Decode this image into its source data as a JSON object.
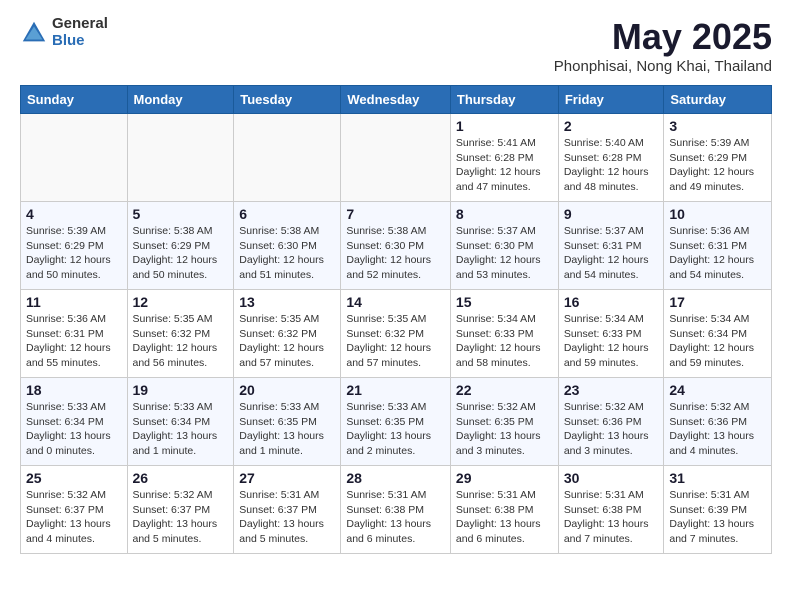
{
  "header": {
    "logo_general": "General",
    "logo_blue": "Blue",
    "month_title": "May 2025",
    "location": "Phonphisai, Nong Khai, Thailand"
  },
  "days_of_week": [
    "Sunday",
    "Monday",
    "Tuesday",
    "Wednesday",
    "Thursday",
    "Friday",
    "Saturday"
  ],
  "weeks": [
    [
      {
        "day": "",
        "info": ""
      },
      {
        "day": "",
        "info": ""
      },
      {
        "day": "",
        "info": ""
      },
      {
        "day": "",
        "info": ""
      },
      {
        "day": "1",
        "info": "Sunrise: 5:41 AM\nSunset: 6:28 PM\nDaylight: 12 hours\nand 47 minutes."
      },
      {
        "day": "2",
        "info": "Sunrise: 5:40 AM\nSunset: 6:28 PM\nDaylight: 12 hours\nand 48 minutes."
      },
      {
        "day": "3",
        "info": "Sunrise: 5:39 AM\nSunset: 6:29 PM\nDaylight: 12 hours\nand 49 minutes."
      }
    ],
    [
      {
        "day": "4",
        "info": "Sunrise: 5:39 AM\nSunset: 6:29 PM\nDaylight: 12 hours\nand 50 minutes."
      },
      {
        "day": "5",
        "info": "Sunrise: 5:38 AM\nSunset: 6:29 PM\nDaylight: 12 hours\nand 50 minutes."
      },
      {
        "day": "6",
        "info": "Sunrise: 5:38 AM\nSunset: 6:30 PM\nDaylight: 12 hours\nand 51 minutes."
      },
      {
        "day": "7",
        "info": "Sunrise: 5:38 AM\nSunset: 6:30 PM\nDaylight: 12 hours\nand 52 minutes."
      },
      {
        "day": "8",
        "info": "Sunrise: 5:37 AM\nSunset: 6:30 PM\nDaylight: 12 hours\nand 53 minutes."
      },
      {
        "day": "9",
        "info": "Sunrise: 5:37 AM\nSunset: 6:31 PM\nDaylight: 12 hours\nand 54 minutes."
      },
      {
        "day": "10",
        "info": "Sunrise: 5:36 AM\nSunset: 6:31 PM\nDaylight: 12 hours\nand 54 minutes."
      }
    ],
    [
      {
        "day": "11",
        "info": "Sunrise: 5:36 AM\nSunset: 6:31 PM\nDaylight: 12 hours\nand 55 minutes."
      },
      {
        "day": "12",
        "info": "Sunrise: 5:35 AM\nSunset: 6:32 PM\nDaylight: 12 hours\nand 56 minutes."
      },
      {
        "day": "13",
        "info": "Sunrise: 5:35 AM\nSunset: 6:32 PM\nDaylight: 12 hours\nand 57 minutes."
      },
      {
        "day": "14",
        "info": "Sunrise: 5:35 AM\nSunset: 6:32 PM\nDaylight: 12 hours\nand 57 minutes."
      },
      {
        "day": "15",
        "info": "Sunrise: 5:34 AM\nSunset: 6:33 PM\nDaylight: 12 hours\nand 58 minutes."
      },
      {
        "day": "16",
        "info": "Sunrise: 5:34 AM\nSunset: 6:33 PM\nDaylight: 12 hours\nand 59 minutes."
      },
      {
        "day": "17",
        "info": "Sunrise: 5:34 AM\nSunset: 6:34 PM\nDaylight: 12 hours\nand 59 minutes."
      }
    ],
    [
      {
        "day": "18",
        "info": "Sunrise: 5:33 AM\nSunset: 6:34 PM\nDaylight: 13 hours\nand 0 minutes."
      },
      {
        "day": "19",
        "info": "Sunrise: 5:33 AM\nSunset: 6:34 PM\nDaylight: 13 hours\nand 1 minute."
      },
      {
        "day": "20",
        "info": "Sunrise: 5:33 AM\nSunset: 6:35 PM\nDaylight: 13 hours\nand 1 minute."
      },
      {
        "day": "21",
        "info": "Sunrise: 5:33 AM\nSunset: 6:35 PM\nDaylight: 13 hours\nand 2 minutes."
      },
      {
        "day": "22",
        "info": "Sunrise: 5:32 AM\nSunset: 6:35 PM\nDaylight: 13 hours\nand 3 minutes."
      },
      {
        "day": "23",
        "info": "Sunrise: 5:32 AM\nSunset: 6:36 PM\nDaylight: 13 hours\nand 3 minutes."
      },
      {
        "day": "24",
        "info": "Sunrise: 5:32 AM\nSunset: 6:36 PM\nDaylight: 13 hours\nand 4 minutes."
      }
    ],
    [
      {
        "day": "25",
        "info": "Sunrise: 5:32 AM\nSunset: 6:37 PM\nDaylight: 13 hours\nand 4 minutes."
      },
      {
        "day": "26",
        "info": "Sunrise: 5:32 AM\nSunset: 6:37 PM\nDaylight: 13 hours\nand 5 minutes."
      },
      {
        "day": "27",
        "info": "Sunrise: 5:31 AM\nSunset: 6:37 PM\nDaylight: 13 hours\nand 5 minutes."
      },
      {
        "day": "28",
        "info": "Sunrise: 5:31 AM\nSunset: 6:38 PM\nDaylight: 13 hours\nand 6 minutes."
      },
      {
        "day": "29",
        "info": "Sunrise: 5:31 AM\nSunset: 6:38 PM\nDaylight: 13 hours\nand 6 minutes."
      },
      {
        "day": "30",
        "info": "Sunrise: 5:31 AM\nSunset: 6:38 PM\nDaylight: 13 hours\nand 7 minutes."
      },
      {
        "day": "31",
        "info": "Sunrise: 5:31 AM\nSunset: 6:39 PM\nDaylight: 13 hours\nand 7 minutes."
      }
    ]
  ]
}
